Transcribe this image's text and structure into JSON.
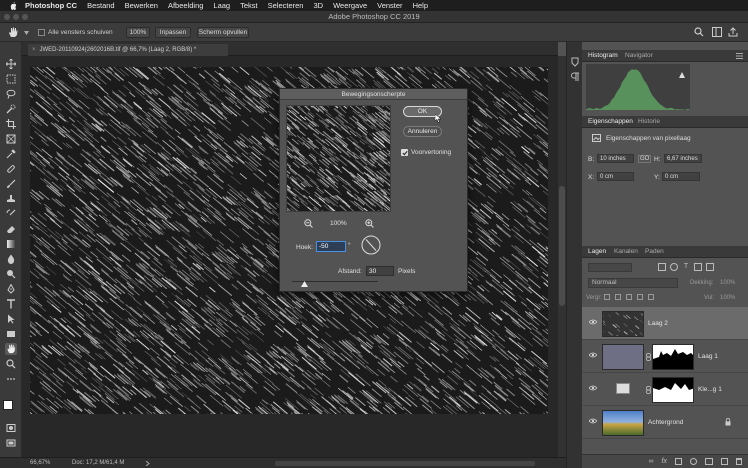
{
  "menubar": {
    "app": "Photoshop CC",
    "items": [
      "Bestand",
      "Bewerken",
      "Afbeelding",
      "Laag",
      "Tekst",
      "Selecteren",
      "3D",
      "Weergave",
      "Venster",
      "Help"
    ]
  },
  "window_title": "Adobe Photoshop CC 2019",
  "options": {
    "scroll_all_label": "Alle vensters schuiven",
    "zoom_100": "100%",
    "fit_label": "Inpassen",
    "fill_screen_label": "Scherm opvullen"
  },
  "document": {
    "tab_title": "JWED-20110924(2602016B.tif @ 66,7% (Laag 2, RGB/8) *"
  },
  "dialog": {
    "title": "Bewegingsonscherpte",
    "ok_label": "OK",
    "cancel_label": "Annuleren",
    "preview_label": "Voorvertoning",
    "preview_checked": true,
    "zoom_value": "100%",
    "angle_label": "Hoek:",
    "angle_value": "-50",
    "angle_unit": "°",
    "distance_label": "Afstand:",
    "distance_value": "30",
    "distance_unit": "Pixels",
    "distance_slider_fraction": 0.15
  },
  "status": {
    "zoom": "66,67%",
    "doc": "Doc: 17,2 M/61,4 M"
  },
  "panels": {
    "histogram_tab": "Histogram",
    "navigator_tab": "Navigator",
    "properties_tab": "Eigenschappen",
    "history_tab": "Historie",
    "pixel_layer_props": "Eigenschappen van pixellaag",
    "w_label": "B:",
    "w_value": "10 inches",
    "link_label": "GO",
    "h_label": "H:",
    "h_value": "6,67 inches",
    "x_label": "X:",
    "x_value": "0 cm",
    "y_label": "Y:",
    "y_value": "0 cm",
    "layers_tab": "Lagen",
    "channels_tab": "Kanalen",
    "paths_tab": "Paden",
    "blend_mode": "Normaal",
    "opacity_label": "Dekking:",
    "opacity_value": "100%",
    "lock_label": "Vergr:",
    "fill_label": "Vul:",
    "fill_value": "100%"
  },
  "layers": [
    {
      "name": "Laag 2",
      "selected": true
    },
    {
      "name": "Laag 1",
      "selected": false
    },
    {
      "name": "Kle...g 1",
      "selected": false
    },
    {
      "name": "Achtergrond",
      "selected": false
    }
  ],
  "colors": {
    "histogram_fill": "#5b9a5e",
    "checkbox": "#2d7fd6"
  }
}
